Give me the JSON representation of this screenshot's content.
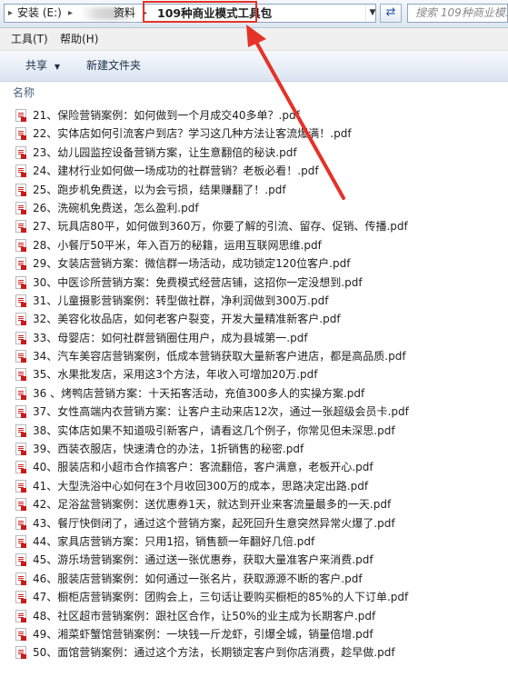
{
  "address": {
    "drive": "安装 (E:)",
    "folder": "资料",
    "current": "109种商业模式工具包",
    "search_placeholder": "搜索 109种商业模..."
  },
  "menu": [
    "工具(T)",
    "帮助(H)"
  ],
  "toolbar": {
    "share": "共享",
    "new_folder": "新建文件夹"
  },
  "list": {
    "column_name": "名称",
    "files": [
      "21、保险营销案例：如何做到一个月成交40多单？.pdf",
      "22、实体店如何引流客户到店？学习这几种方法让客流爆满！.pdf",
      "23、幼儿园监控设备营销方案，让生意翻倍的秘诀.pdf",
      "24、建材行业如何做一场成功的社群营销？老板必看！.pdf",
      "25、跑步机免费送，以为会亏损，结果赚翻了！.pdf",
      "26、洗碗机免费送，怎么盈利.pdf",
      "27、玩具店80平，如何做到360万，你要了解的引流、留存、促销、传播.pdf",
      "28、小餐厅50平米，年入百万的秘籍，运用互联网思维.pdf",
      "29、女装店营销方案：微信群一场活动，成功锁定120位客户.pdf",
      "30、中医诊所营销方案：免费模式经营店铺，这招你一定没想到.pdf",
      "31、儿童摄影营销案例：转型做社群，净利润做到300万.pdf",
      "32、美容化妆品店，如何老客户裂变，开发大量精准新客户.pdf",
      "33、母婴店：如何社群营销圈住用户，成为县城第一.pdf",
      "34、汽车美容店营销案例，低成本营销获取大量新客户进店，都是高品质.pdf",
      "35、水果批发店，采用这3个方法，年收入可增加20万.pdf",
      "36 、烤鸭店营销方案：十天拓客活动，充值300多人的实操方案.pdf",
      "37、女性高端内衣营销方案：让客户主动来店12次，通过一张超级会员卡.pdf",
      "38、实体店如果不知道吸引新客户，请看这几个例子，你常见但未深思.pdf",
      "39、西装衣服店，快速清仓的办法，1折销售的秘密.pdf",
      "40、服装店和小超市合作搞客户：客流翻倍，客户满意，老板开心.pdf",
      "41、大型洗浴中心如何在3个月收回300万的成本，思路决定出路.pdf",
      "42、足浴盆营销案例：送优惠券1天，就达到开业来客流量最多的一天.pdf",
      "43、餐厅快倒闭了，通过这个营销方案，起死回升生意突然异常火爆了.pdf",
      "44、家具店营销方案：只用1招，销售额一年翻好几倍.pdf",
      "45、游乐场营销案例：通过送一张优惠券，获取大量准客户来消费.pdf",
      "46、服装店营销案例：如何通过一张名片，获取源源不断的客户.pdf",
      "47、橱柜店营销案例：团购会上，三句话让要购买橱柜的85%的人下订单.pdf",
      "48、社区超市营销案例：跟社区合作，让50%的业主成为长期客户.pdf",
      "49、湘菜虾蟹馆营销案例：一块钱一斤龙虾，引爆全城，销量倍增.pdf",
      "50、面馆营销案例：通过这个方法，长期锁定客户到你店消费，趁早做.pdf"
    ]
  }
}
